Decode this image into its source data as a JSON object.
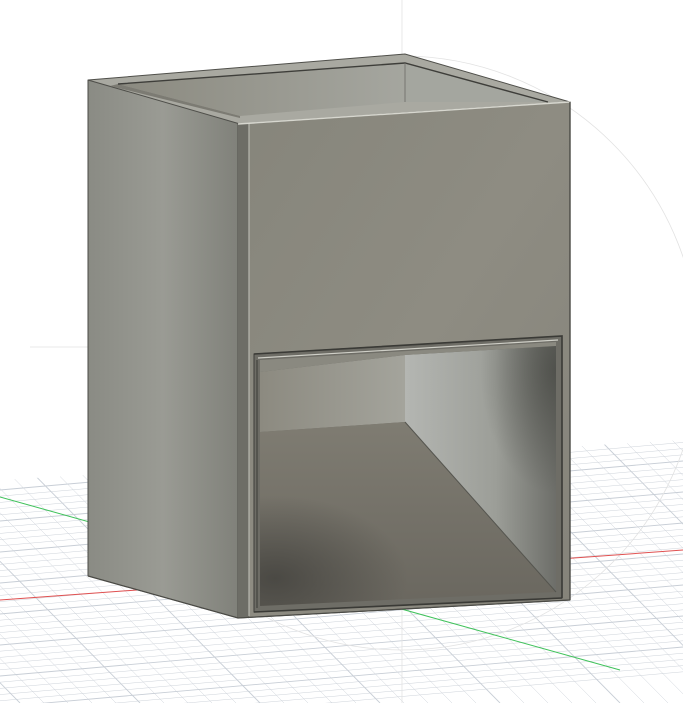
{
  "scene": {
    "model_color": "#8d8b81",
    "background_color": "#ffffff",
    "grid_color": "#c8ced6",
    "x_axis_color": "#e05050",
    "y_axis_color": "#3fc25a"
  }
}
